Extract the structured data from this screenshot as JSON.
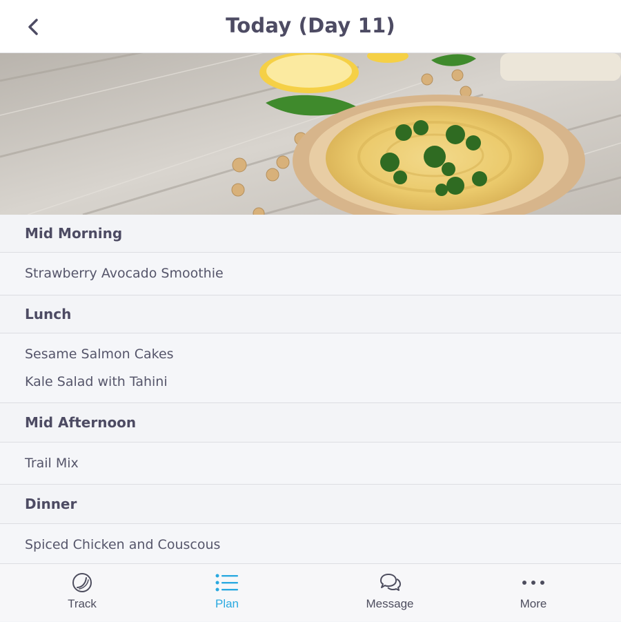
{
  "header": {
    "title": "Today (Day 11)",
    "back_icon": "chevron-left-icon"
  },
  "meals": [
    {
      "name": "Mid Morning",
      "items": [
        "Strawberry Avocado Smoothie"
      ]
    },
    {
      "name": "Lunch",
      "items": [
        "Sesame Salmon Cakes",
        "Kale Salad with Tahini"
      ]
    },
    {
      "name": "Mid Afternoon",
      "items": [
        "Trail Mix"
      ]
    },
    {
      "name": "Dinner",
      "items": [
        "Spiced Chicken and Couscous"
      ]
    }
  ],
  "tabbar": {
    "tabs": [
      {
        "label": "Track",
        "icon": "track-icon",
        "active": false
      },
      {
        "label": "Plan",
        "icon": "list-icon",
        "active": true
      },
      {
        "label": "Message",
        "icon": "chat-icon",
        "active": false
      },
      {
        "label": "More",
        "icon": "more-dots-icon",
        "active": false
      }
    ]
  },
  "colors": {
    "accent": "#2aa9e0",
    "title": "#4d4b63",
    "background": "#f3f4f7"
  }
}
